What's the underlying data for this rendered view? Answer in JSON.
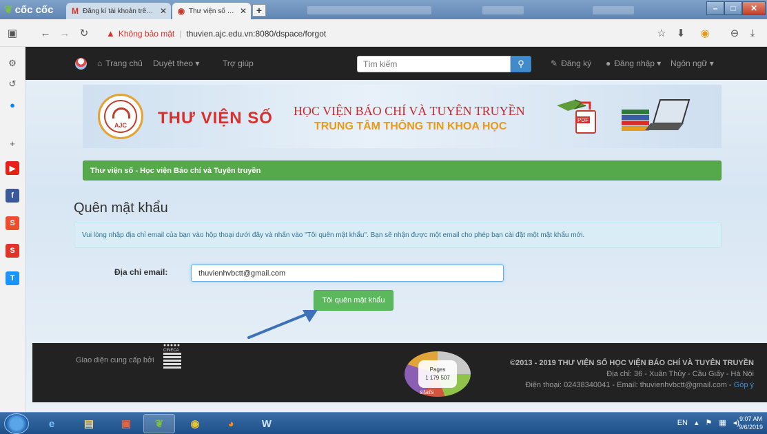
{
  "browser": {
    "brand": "cốc cốc",
    "tabs": [
      {
        "icon": "M",
        "title": "Đăng kí tài khoản trên thư",
        "close": "✕"
      },
      {
        "icon": "◉",
        "title": "Thư viện số - Học viện Báo",
        "close": "✕"
      }
    ],
    "new_tab": "+",
    "security_label": "Không bảo mật",
    "url": "thuvien.ajc.edu.vn:8080/dspace/forgot"
  },
  "site_nav": {
    "home": "Trang chủ",
    "browse": "Duyệt theo ▾",
    "help": "Trợ giúp",
    "search_placeholder": "Tìm kiếm",
    "register": "Đăng ký",
    "login": "Đăng nhập ▾",
    "language": "Ngôn ngữ ▾"
  },
  "banner": {
    "library_name": "THƯ VIỆN SỐ",
    "academy": "HỌC VIỆN BÁO CHÍ VÀ TUYÊN TRUYỀN",
    "center": "TRUNG TÂM THÔNG TIN KHOA HỌC",
    "logo_text": "AJC",
    "pdf_text": "PDF"
  },
  "breadcrumb": "Thư viện số - Học viện Báo chí và Tuyên truyền",
  "form": {
    "title": "Quên mật khẩu",
    "instructions": "Vui lòng nhập địa chỉ email của bạn vào hộp thoại dưới đây và nhấn vào \"Tôi quên mật khẩu\". Bạn sẽ nhận được một email cho phép bạn cài đặt một mật khẩu mới.",
    "email_label": "Địa chỉ email:",
    "email_value": "thuvienhvbctt@gmail.com",
    "submit_label": "Tôi quên mật khẩu"
  },
  "footer": {
    "credit": "Giao diện cung cấp bởi",
    "credit_brand": "CINECA",
    "counter_label": "Pages",
    "counter_value": "1 179 507",
    "counter_brand": "stats",
    "copyright": "©2013 - 2019 THƯ VIỆN SỐ HỌC VIỆN BÁO CHÍ VÀ TUYÊN TRUYỀN",
    "address": "Địa chỉ: 36 - Xuân Thủy - Cầu Giấy - Hà Nội",
    "contact": "Điện thoại: 02438340041 - Email: thuvienhvbctt@gmail.com - ",
    "feedback": "Góp ý"
  },
  "taskbar": {
    "lang": "EN",
    "time": "9:07 AM",
    "date": "9/6/2019"
  },
  "colors": {
    "navbar": "#222222",
    "breadcrumb_green": "#56a94a",
    "button_green": "#5cb85c",
    "search_blue": "#428bca",
    "alert_bg": "#d9edf7",
    "arrow_blue": "#3d72b8"
  }
}
